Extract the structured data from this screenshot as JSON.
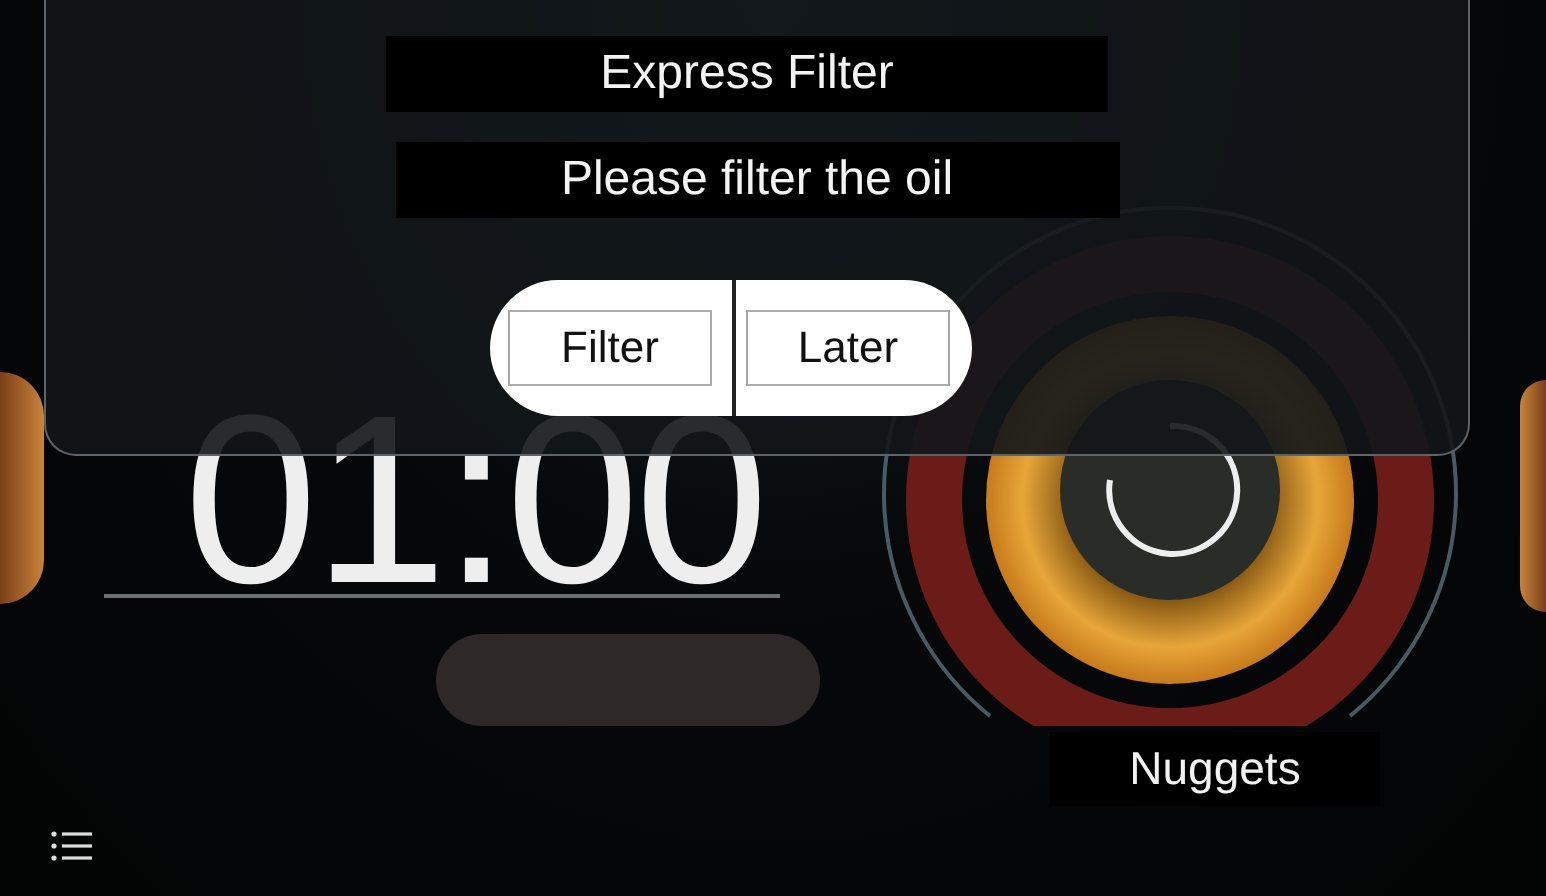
{
  "dialog": {
    "title": "Express Filter",
    "message": "Please filter the oil",
    "buttons": [
      {
        "label": "Filter"
      },
      {
        "label": "Later"
      }
    ]
  },
  "timer": {
    "value": "01:00"
  },
  "product": {
    "name": "Nuggets"
  }
}
